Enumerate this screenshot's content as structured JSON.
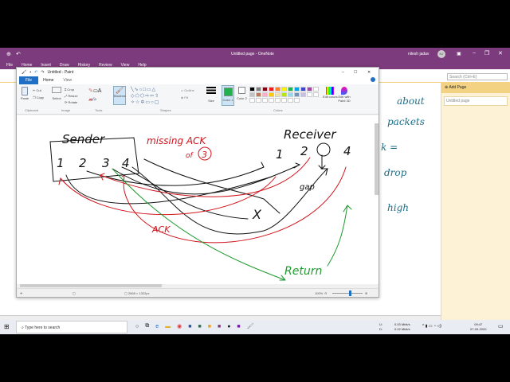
{
  "onenote": {
    "title": "Untitled page - OneNote",
    "user": "nilesh jadav",
    "avatar": "NJ",
    "menu": [
      "File",
      "Home",
      "Insert",
      "Draw",
      "History",
      "Review",
      "View",
      "Help"
    ],
    "search_placeholder": "Search (Ctrl+E)",
    "add_page": "Add Page",
    "pages": [
      "Untitled page"
    ],
    "note_text": [
      "about",
      "packets",
      "k =",
      "drop",
      "high"
    ]
  },
  "paint": {
    "title": "Untitled - Paint",
    "tabs": [
      "File",
      "Home",
      "View"
    ],
    "groups": {
      "clipboard": "Clipboard",
      "image": "Image",
      "tools": "Tools",
      "shapes": "Shapes",
      "colors": "Colors"
    },
    "buttons": {
      "paste": "Paste",
      "cut": "Cut",
      "copy": "Copy",
      "select": "Select",
      "crop": "Crop",
      "resize": "Resize",
      "rotate": "Rotate",
      "brushes": "Brushes",
      "outline": "Outline",
      "fill": "Fill",
      "size": "Size",
      "color1": "Color 1",
      "color2": "Color 2",
      "edit_colors": "Edit colors",
      "paint3d": "Edit with Paint 3D"
    },
    "palette": [
      "#000000",
      "#7f7f7f",
      "#880015",
      "#ed1c24",
      "#ff7f27",
      "#fff200",
      "#22b14c",
      "#00a2e8",
      "#3f48cc",
      "#a349a4",
      "#ffffff",
      "#c3c3c3",
      "#b97a57",
      "#ffaec9",
      "#ffc90e",
      "#efe4b0",
      "#b5e61d",
      "#99d9ea",
      "#7092be",
      "#c8bfe7"
    ],
    "color1": "#22b14c",
    "color2": "#ffffff",
    "status": {
      "size": "2668 × 1322px",
      "zoom": "100%",
      "zoom_fraction": 0.55
    },
    "drawing": {
      "sender": "Sender",
      "sender_nums": [
        "1",
        "2",
        "3",
        "4"
      ],
      "missing": "missing ACK",
      "of3": "of",
      "three": "3",
      "receiver": "Receiver",
      "recv_nums": [
        "1",
        "2",
        "4"
      ],
      "gap": "gap",
      "x": "X",
      "ack": "ACK",
      "retrn": "Return"
    }
  },
  "taskbar": {
    "search": "Type here to search",
    "net_up": "0.03 Mbit/s",
    "net_down": "0.02 Mbit/s",
    "u": "U:",
    "d": "D:",
    "time": "09:47",
    "date": "07-09-2020"
  }
}
